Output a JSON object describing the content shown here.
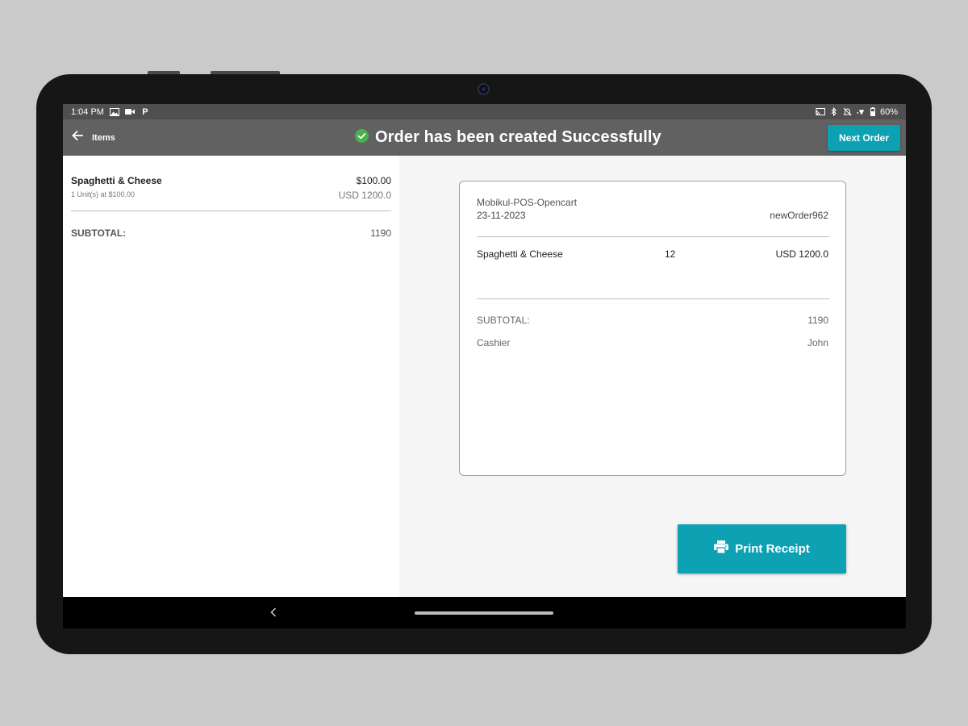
{
  "statusbar": {
    "time": "1:04 PM",
    "battery": "60%",
    "left_icons": [
      "gallery-icon",
      "video-icon",
      "p-app-icon"
    ],
    "right_icons": [
      "cast-icon",
      "bluetooth-icon",
      "mute-icon",
      "wifi-icon",
      "battery-icon"
    ]
  },
  "appbar": {
    "back_label": "Items",
    "title": "Order has been created Successfully",
    "next_order_label": "Next Order",
    "success_color": "#4caf50",
    "accent_color": "#0ca2b4"
  },
  "cart": {
    "items": [
      {
        "name": "Spaghetti & Cheese",
        "unit_info": "1 Unit(s) at $100.00",
        "price": "$100.00",
        "total": "USD 1200.0"
      }
    ],
    "subtotal_label": "SUBTOTAL:",
    "subtotal_value": "1190"
  },
  "receipt": {
    "store": "Mobikul-POS-Opencart",
    "date": "23-11-2023",
    "order_id": "newOrder962",
    "items": [
      {
        "name": "Spaghetti & Cheese",
        "qty": "12",
        "total": "USD 1200.0"
      }
    ],
    "subtotal_label": "SUBTOTAL:",
    "subtotal_value": "1190",
    "cashier_label": "Cashier",
    "cashier_value": "John"
  },
  "actions": {
    "print_label": "Print Receipt"
  }
}
